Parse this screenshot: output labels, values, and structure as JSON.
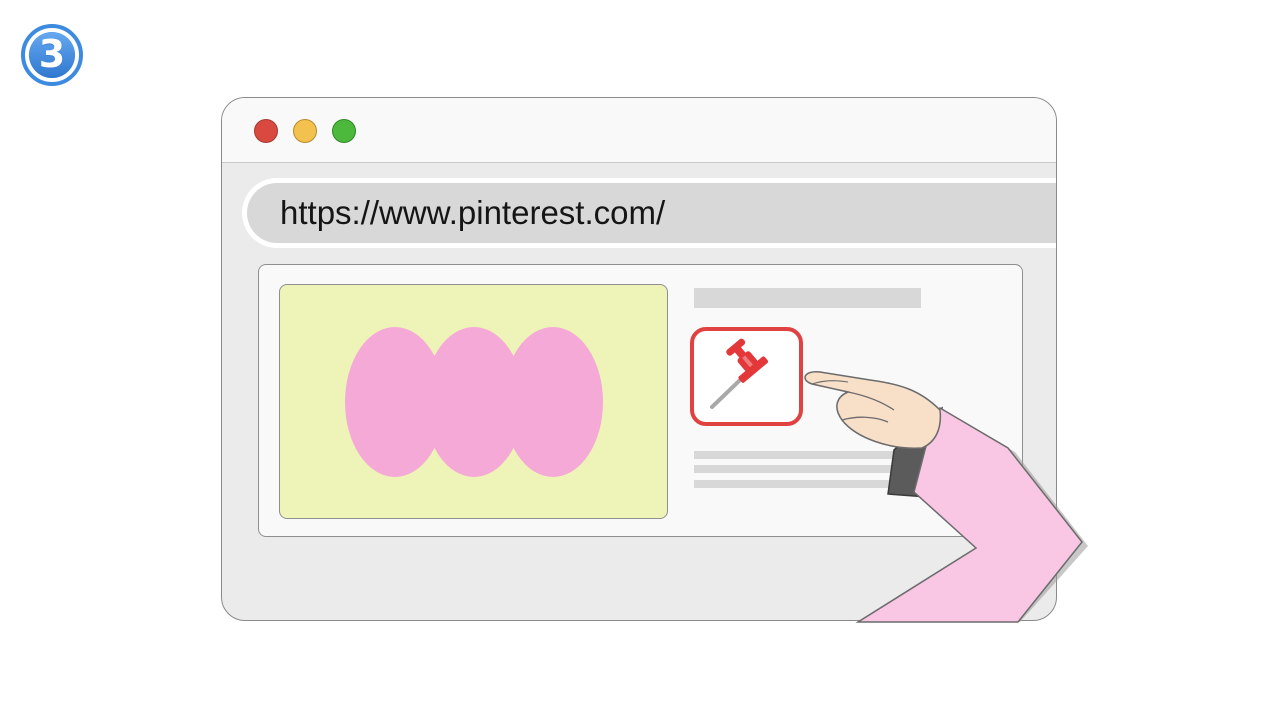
{
  "step": {
    "number": "3",
    "icon": "circled-number-icon",
    "color": "#3c8be0"
  },
  "browser": {
    "window_controls": [
      {
        "name": "close",
        "color": "#d9493f"
      },
      {
        "name": "minimize",
        "color": "#f2c14e"
      },
      {
        "name": "maximize",
        "color": "#4cb83c"
      }
    ],
    "address_bar": {
      "url": "https://www.pinterest.com/"
    }
  },
  "page": {
    "image_tile": {
      "background": "#eef3b7",
      "shape_color": "#f5a9d6"
    },
    "pin_button": {
      "icon": "pushpin-icon",
      "border_color": "#e04242",
      "pin_color": "#e3373a"
    }
  },
  "hand": {
    "icon": "pointing-hand-icon",
    "sleeve_color": "#f9c6e3",
    "skin_color": "#f7dfc8"
  }
}
